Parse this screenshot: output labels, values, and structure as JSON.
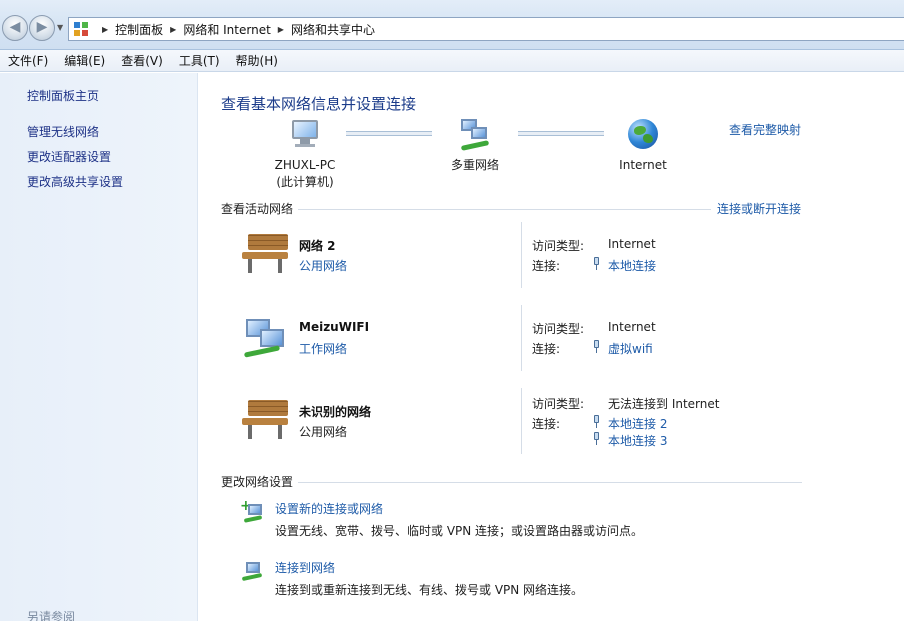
{
  "address": {
    "crumbs": [
      "控制面板",
      "网络和 Internet",
      "网络和共享中心"
    ]
  },
  "menu": [
    "文件(F)",
    "编辑(E)",
    "查看(V)",
    "工具(T)",
    "帮助(H)"
  ],
  "sidebar": {
    "home": "控制面板主页",
    "items": [
      "管理无线网络",
      "更改适配器设置",
      "更改高级共享设置"
    ],
    "see_also": "另请参阅"
  },
  "main": {
    "title": "查看基本网络信息并设置连接",
    "full_map": "查看完整映射",
    "map": {
      "pc_name": "ZHUXL-PC",
      "pc_sub": "(此计算机)",
      "multi": "多重网络",
      "internet": "Internet"
    }
  },
  "active": {
    "header": "查看活动网络",
    "connect_link": "连接或断开连接",
    "networks": [
      {
        "name": "网络  2",
        "type": "公用网络",
        "type_link": true,
        "access_label": "访问类型:",
        "access": "Internet",
        "conn_label": "连接:",
        "connections": [
          "本地连接"
        ]
      },
      {
        "name": "MeizuWIFI",
        "type": "工作网络",
        "type_link": true,
        "access_label": "访问类型:",
        "access": "Internet",
        "conn_label": "连接:",
        "connections": [
          "虚拟wifi"
        ]
      },
      {
        "name": "未识别的网络",
        "type": "公用网络",
        "type_link": false,
        "access_label": "访问类型:",
        "access": "无法连接到 Internet",
        "conn_label": "连接:",
        "connections": [
          "本地连接 2",
          "本地连接 3"
        ]
      }
    ]
  },
  "change": {
    "header": "更改网络设置",
    "tasks": [
      {
        "title": "设置新的连接或网络",
        "desc": "设置无线、宽带、拨号、临时或 VPN 连接；或设置路由器或访问点。"
      },
      {
        "title": "连接到网络",
        "desc": "连接到或重新连接到无线、有线、拨号或 VPN 网络连接。"
      }
    ]
  },
  "colors": {
    "link": "#1e5ba8",
    "title": "#1c3c8a",
    "sidebar_link": "#1e3287"
  }
}
